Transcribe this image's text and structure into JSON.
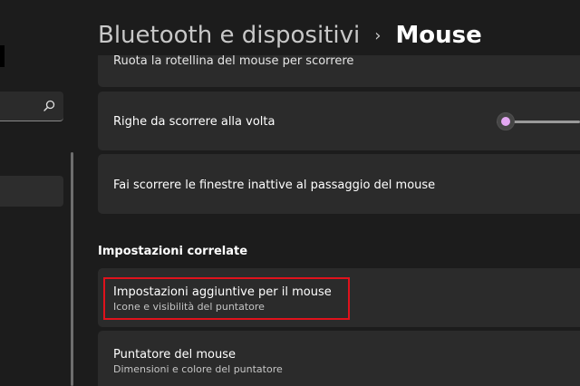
{
  "header": {
    "parent": "Bluetooth e dispositivi",
    "separator": "›",
    "current": "Mouse"
  },
  "settings": {
    "scroll_wheel_label": "Ruota la rotellina del mouse per scorrere",
    "lines_label": "Righe da scorrere alla volta",
    "lines_slider_value": 0.05,
    "inactive_scroll_label": "Fai scorrere le finestre inattive al passaggio del mouse"
  },
  "related": {
    "heading": "Impostazioni correlate",
    "items": [
      {
        "title": "Impostazioni aggiuntive per il mouse",
        "subtitle": "Icone e visibilità del puntatore"
      },
      {
        "title": "Puntatore del mouse",
        "subtitle": "Dimensioni e colore del puntatore"
      }
    ]
  },
  "colors": {
    "accent": "#e3a8f2",
    "highlight": "#e0121c",
    "card": "#2b2b2b",
    "background": "#1c1c1c"
  },
  "icons": {
    "search": "search-icon"
  }
}
